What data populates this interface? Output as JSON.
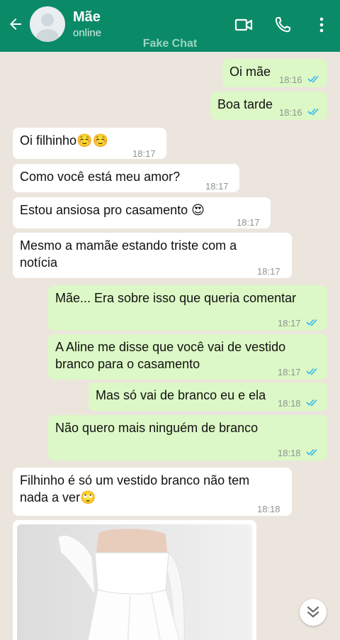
{
  "header": {
    "contact_name": "Mãe",
    "status": "online",
    "watermark": "Fake Chat",
    "icons": [
      "back-arrow-icon",
      "avatar-placeholder",
      "video-call-icon",
      "phone-icon",
      "more-options-icon"
    ]
  },
  "colors": {
    "header_bg": "#0b8a68",
    "chat_bg": "#ece5dd",
    "incoming_bubble": "#ffffff",
    "outgoing_bubble": "#dcf8c6",
    "read_ticks": "#34b7f1"
  },
  "messages": [
    {
      "direction": "out",
      "text": "Oi mãe",
      "time": "18:16",
      "status": "read"
    },
    {
      "direction": "out",
      "text": "Boa tarde",
      "time": "18:16",
      "status": "read"
    },
    {
      "direction": "in",
      "text": "Oi filhinho☺️☺️",
      "time": "18:17"
    },
    {
      "direction": "in",
      "text": "Como você está meu amor?",
      "time": "18:17"
    },
    {
      "direction": "in",
      "text": "Estou ansiosa pro casamento 😍",
      "time": "18:17"
    },
    {
      "direction": "in",
      "text": "Mesmo a mamãe estando triste com a notícia",
      "time": "18:17"
    },
    {
      "direction": "out",
      "text": "Mãe... Era sobre isso que queria comentar",
      "time": "18:17",
      "status": "read"
    },
    {
      "direction": "out",
      "text": "A Aline me disse que você vai de vestido branco para o casamento",
      "time": "18:17",
      "status": "read"
    },
    {
      "direction": "out",
      "text": "Mas só vai de branco eu e ela",
      "time": "18:18",
      "status": "read"
    },
    {
      "direction": "out",
      "text": "Não quero mais ninguém de branco",
      "time": "18:18",
      "status": "read"
    },
    {
      "direction": "in",
      "text": "Filhinho é só um vestido branco não tem nada a ver🙄",
      "time": "18:18"
    },
    {
      "direction": "in",
      "type": "image",
      "content": "white-dress-photo"
    }
  ],
  "scroll_button": "double-chevron-down-icon"
}
